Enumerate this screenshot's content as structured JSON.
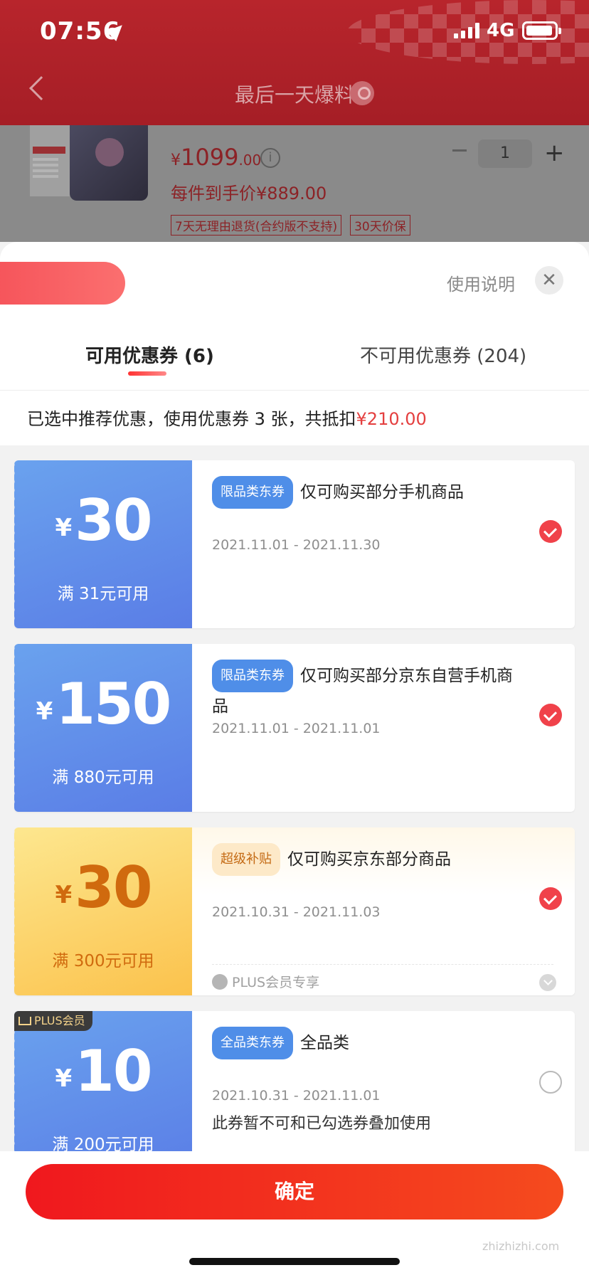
{
  "status_bar": {
    "time": "07:56",
    "network": "4G"
  },
  "nav": {
    "title": "最后一天爆料"
  },
  "product": {
    "price_symbol": "¥",
    "price_int": "1099",
    "price_dec": ".00",
    "final_price": "每件到手价¥889.00",
    "tags": [
      "7天无理由退货(合约版不支持)",
      "30天价保"
    ],
    "quantity": "1"
  },
  "sheet": {
    "help_link": "使用说明",
    "tabs": [
      {
        "label": "可用优惠券 (6)",
        "active": true
      },
      {
        "label": "不可用优惠券 (204)",
        "active": false
      }
    ],
    "summary_prefix": "已选中推荐优惠，使用优惠券 3 张，共抵扣",
    "summary_amount": "¥210.00"
  },
  "coupons": [
    {
      "yen": "¥",
      "amount": "30",
      "condition": "满 31元可用",
      "badge": "限品类东券",
      "title": "仅可购买部分手机商品",
      "dates": "2021.11.01 - 2021.11.30",
      "checked": true,
      "style": "blue"
    },
    {
      "yen": "¥",
      "amount": "150",
      "condition": "满 880元可用",
      "badge": "限品类东券",
      "title": "仅可购买部分京东自营手机商品",
      "dates": "2021.11.01 - 2021.11.01",
      "checked": true,
      "style": "blue"
    },
    {
      "yen": "¥",
      "amount": "30",
      "condition": "满 300元可用",
      "badge": "超级补贴",
      "title": "仅可购买京东部分商品",
      "dates": "2021.10.31 - 2021.11.03",
      "checked": true,
      "style": "gold",
      "plus_note": "PLUS会员专享"
    },
    {
      "yen": "¥",
      "amount": "10",
      "condition": "满 200元可用",
      "badge": "全品类东券",
      "title": "全品类",
      "dates": "2021.10.31 - 2021.11.01",
      "note": "此券暂不可和已勾选券叠加使用",
      "checked": false,
      "style": "blue",
      "corner_tag": "PLUS会员"
    }
  ],
  "footer": {
    "confirm_label": "确定",
    "watermark": "zhizhizhi.com"
  },
  "colors": {
    "accent": "#f0424a",
    "coupon_blue": "#5a7de6",
    "coupon_gold": "#fbc24c"
  }
}
